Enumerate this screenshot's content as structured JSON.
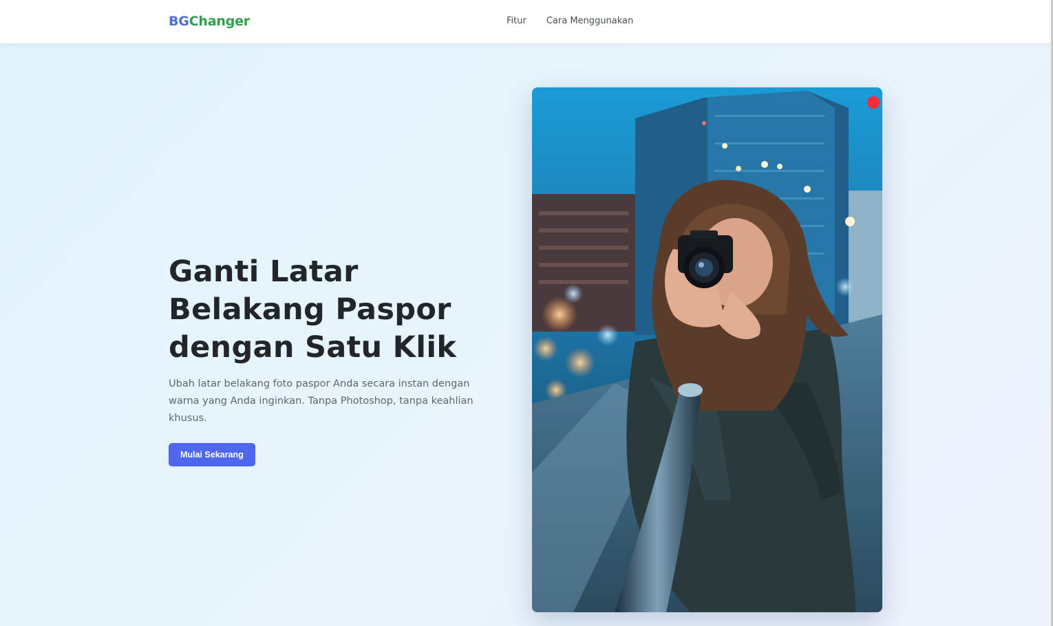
{
  "navbar": {
    "brand_prefix": "BG",
    "brand_suffix": "Changer",
    "links": [
      {
        "label": "Fitur"
      },
      {
        "label": "Cara Menggunakan"
      }
    ]
  },
  "hero": {
    "title": "Ganti Latar Belakang Paspor dengan Satu Klik",
    "description": "Ubah latar belakang foto paspor Anda secara instan dengan warna yang Anda inginkan. Tanpa Photoshop, tanpa keahlian khusus.",
    "cta_label": "Mulai Sekarang"
  },
  "colors": {
    "brand_primary": "#4f6fd8",
    "brand_secondary": "#2f9e4f",
    "button": "#4f67ee",
    "title_text": "#22262b"
  }
}
